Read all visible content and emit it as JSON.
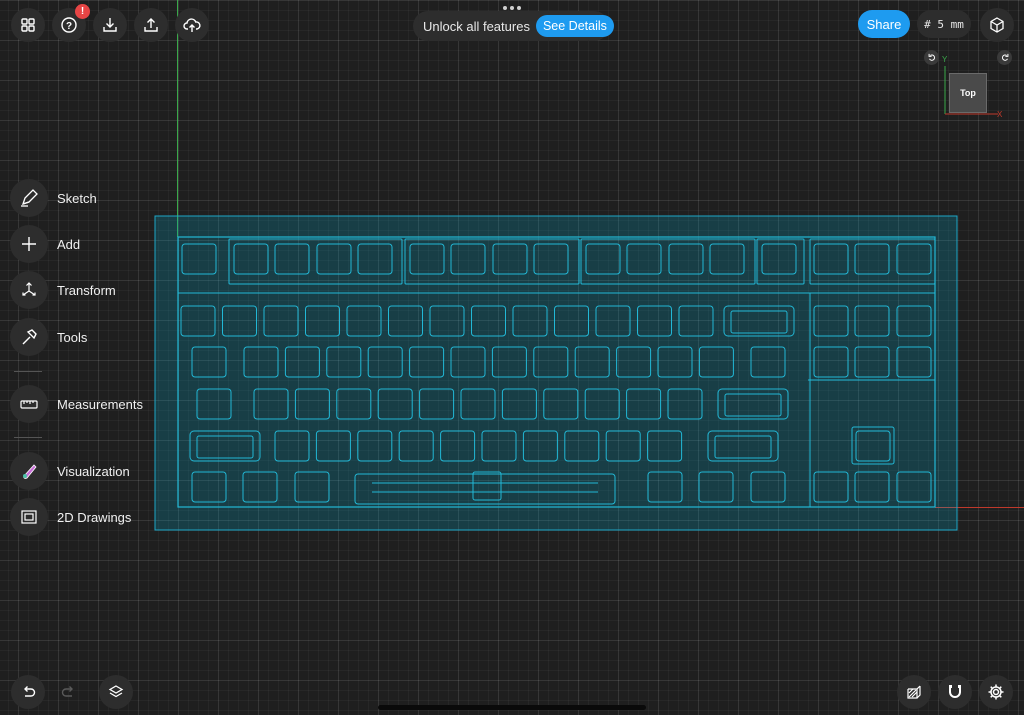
{
  "banner": {
    "text": "Unlock all features",
    "button": "See Details"
  },
  "toolbar": {
    "badge": "!",
    "share_label": "Share",
    "grid_label": "# 5 mm"
  },
  "sidebar": {
    "items": [
      {
        "label": "Sketch",
        "icon": "pencil-icon"
      },
      {
        "label": "Add",
        "icon": "plus-icon"
      },
      {
        "label": "Transform",
        "icon": "transform-icon"
      },
      {
        "label": "Tools",
        "icon": "hammer-icon"
      },
      {
        "label": "Measurements",
        "icon": "ruler-icon"
      },
      {
        "label": "Visualization",
        "icon": "palette-icon"
      },
      {
        "label": "2D Drawings",
        "icon": "drawing-icon"
      }
    ]
  },
  "view_cube": {
    "face": "Top",
    "x_label": "X",
    "y_label": "Y"
  },
  "colors": {
    "accent": "#1e9bf0",
    "sketch": "#00bcd4",
    "y_axis": "#3aa84a",
    "x_axis": "#c0392b",
    "badge": "#e74545"
  }
}
